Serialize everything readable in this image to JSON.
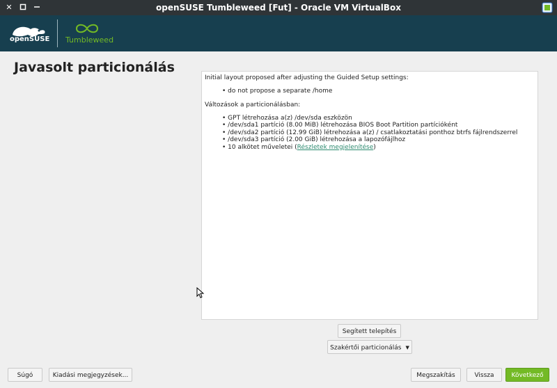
{
  "window": {
    "title": "openSUSE Tumbleweed [Fut] - Oracle VM VirtualBox"
  },
  "banner": {
    "brand_text": "openSUSE",
    "product_text": "Tumbleweed"
  },
  "page": {
    "title": "Javasolt particionálás"
  },
  "proposal": {
    "intro": "Initial layout proposed after adjusting the Guided Setup settings:",
    "intro_items": [
      "do not propose a separate /home"
    ],
    "changes_heading": "Változások a particionálásban:",
    "changes_items": [
      "GPT létrehozása a(z) /dev/sda eszközön",
      "/dev/sda1 partíció (8.00 MiB) létrehozása BIOS Boot Partition partícióként",
      "/dev/sda2 partíció (12.99 GiB) létrehozása a(z) / csatlakoztatási ponthoz btrfs fájlrendszerrel",
      "/dev/sda3 partíció (2.00 GiB) létrehozása a lapozófájlhoz"
    ],
    "subvolume_prefix": "10 alkötet műveletei (",
    "subvolume_link": "Részletek megjelenítése",
    "subvolume_suffix": ")"
  },
  "buttons": {
    "guided_setup": "Segített telepítés",
    "expert_partitioner": "Szakértői particionálás",
    "help": "Súgó",
    "release_notes": "Kiadási megjegyzések...",
    "abort": "Megszakítás",
    "back": "Vissza",
    "next": "Következő"
  },
  "colors": {
    "banner_bg": "#173f4f",
    "accent_green": "#73ba25",
    "titlebar_bg": "#2f3437",
    "link": "#2c8a6f"
  },
  "icons": {
    "titlebar_close": "close-icon",
    "titlebar_maximize": "maximize-icon",
    "titlebar_minimize": "minimize-icon",
    "virtualbox": "virtualbox-icon",
    "expert_dropdown": "caret-down-icon"
  }
}
